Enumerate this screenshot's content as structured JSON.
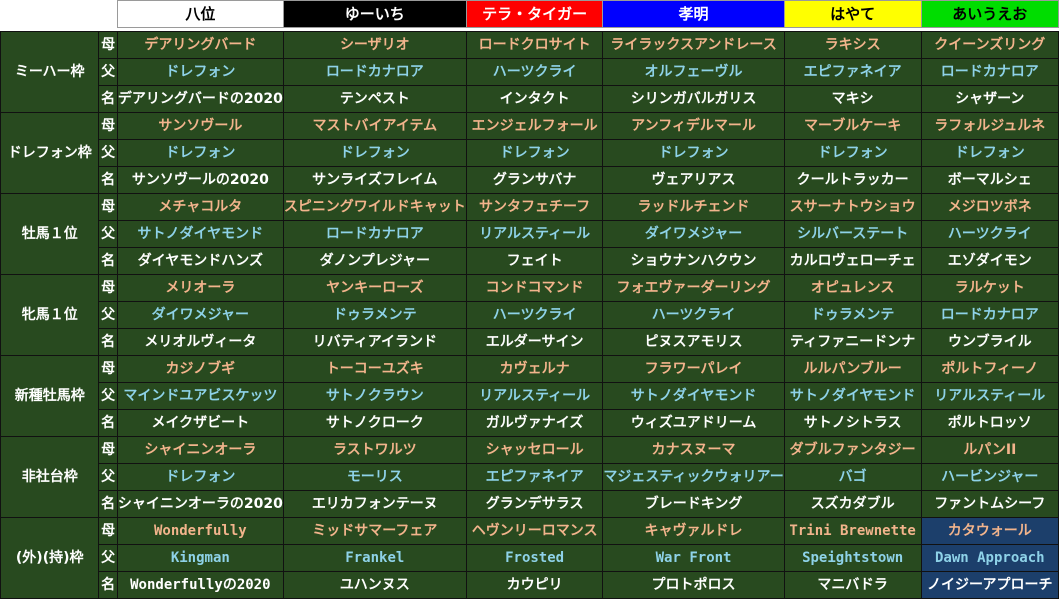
{
  "header": {
    "players": [
      {
        "name": "八位",
        "bg": "#ffffff",
        "fg": "#000000"
      },
      {
        "name": "ゆーいち",
        "bg": "#000000",
        "fg": "#ffffff"
      },
      {
        "name": "テラ・タイガー",
        "bg": "#ff0000",
        "fg": "#ffffff"
      },
      {
        "name": "孝明",
        "bg": "#0000ff",
        "fg": "#ffffff"
      },
      {
        "name": "はやて",
        "bg": "#ffff00",
        "fg": "#000000"
      },
      {
        "name": "あいうえお",
        "bg": "#00dd00",
        "fg": "#000000"
      }
    ]
  },
  "row_labels": {
    "dam": "母",
    "sire": "父",
    "name": "名"
  },
  "groups": [
    {
      "label": "ミーハー枠",
      "dam": [
        "デアリングバード",
        "シーザリオ",
        "ロードクロサイト",
        "ライラックスアンドレース",
        "ラキシス",
        "クイーンズリング"
      ],
      "sire": [
        "ドレフォン",
        "ロードカナロア",
        "ハーツクライ",
        "オルフェーヴル",
        "エピファネイア",
        "ロードカナロア"
      ],
      "name": [
        "デアリングバードの2020",
        "テンペスト",
        "インタクト",
        "シリンガバルガリス",
        "マキシ",
        "シャザーン"
      ]
    },
    {
      "label": "ドレフォン枠",
      "dam": [
        "サンソヴール",
        "マストバイアイテム",
        "エンジェルフォール",
        "アンフィデルマール",
        "マーブルケーキ",
        "ラフォルジュルネ"
      ],
      "sire": [
        "ドレフォン",
        "ドレフォン",
        "ドレフォン",
        "ドレフォン",
        "ドレフォン",
        "ドレフォン"
      ],
      "name": [
        "サンソヴールの2020",
        "サンライズフレイム",
        "グランサバナ",
        "ヴェアリアス",
        "クールトラッカー",
        "ボーマルシェ"
      ]
    },
    {
      "label": "牡馬１位",
      "dam": [
        "メチャコルタ",
        "スピニングワイルドキャット",
        "サンタフェチーフ",
        "ラッドルチェンド",
        "スサーナトウショウ",
        "メジロツボネ"
      ],
      "sire": [
        "サトノダイヤモンド",
        "ロードカナロア",
        "リアルスティール",
        "ダイワメジャー",
        "シルバーステート",
        "ハーツクライ"
      ],
      "name": [
        "ダイヤモンドハンズ",
        "ダノンプレジャー",
        "フェイト",
        "ショウナンハクウン",
        "カルロヴェローチェ",
        "エゾダイモン"
      ]
    },
    {
      "label": "牝馬１位",
      "dam": [
        "メリオーラ",
        "ヤンキーローズ",
        "コンドコマンド",
        "フォエヴァーダーリング",
        "オピュレンス",
        "ラルケット"
      ],
      "sire": [
        "ダイワメジャー",
        "ドゥラメンテ",
        "ハーツクライ",
        "ハーツクライ",
        "ドゥラメンテ",
        "ロードカナロア"
      ],
      "name": [
        "メリオルヴィータ",
        "リバティアイランド",
        "エルダーサイン",
        "ピヌスアモリス",
        "ティファニードンナ",
        "ウンブライル"
      ]
    },
    {
      "label": "新種牡馬枠",
      "dam": [
        "カジノブギ",
        "トーコーユズキ",
        "カヴェルナ",
        "フラワーパレイ",
        "ルルパンブルー",
        "ポルトフィーノ"
      ],
      "sire": [
        "マインドユアビスケッツ",
        "サトノクラウン",
        "リアルスティール",
        "サトノダイヤモンド",
        "サトノダイヤモンド",
        "リアルスティール"
      ],
      "name": [
        "メイクザビート",
        "サトノクローク",
        "ガルヴァナイズ",
        "ウィズユアドリーム",
        "サトノシトラス",
        "ポルトロッソ"
      ]
    },
    {
      "label": "非社台枠",
      "dam": [
        "シャイニンオーラ",
        "ラストワルツ",
        "シャッセロール",
        "カナスヌーマ",
        "ダブルファンタジー",
        "ルパンII"
      ],
      "sire": [
        "ドレフォン",
        "モーリス",
        "エピファネイア",
        "マジェスティックウォリアー",
        "バゴ",
        "ハービンジャー"
      ],
      "name": [
        "シャイニンオーラの2020",
        "エリカフォンテーヌ",
        "グランデサラス",
        "ブレードキング",
        "スズカダブル",
        "ファントムシーフ"
      ]
    },
    {
      "label": "(外)(持)枠",
      "dam": [
        "Wonderfully",
        "ミッドサマーフェア",
        "ヘヴンリーロマンス",
        "キャヴァルドレ",
        "Trini Brewnette",
        "カタウォール"
      ],
      "sire": [
        "Kingman",
        "Frankel",
        "Frosted",
        "War Front",
        "Speightstown",
        "Dawn Approach"
      ],
      "name": [
        "Wonderfullyの2020",
        "ユハンヌス",
        "カウピリ",
        "プロトポロス",
        "マニバドラ",
        "ノイジーアプローチ"
      ]
    }
  ],
  "colors": {
    "cell_bg": "#284a1f",
    "dam_text": "#f2b48c",
    "sire_text": "#8ed2e8",
    "name_text": "#ffffff",
    "highlight_bg": "#1c3f6b"
  }
}
